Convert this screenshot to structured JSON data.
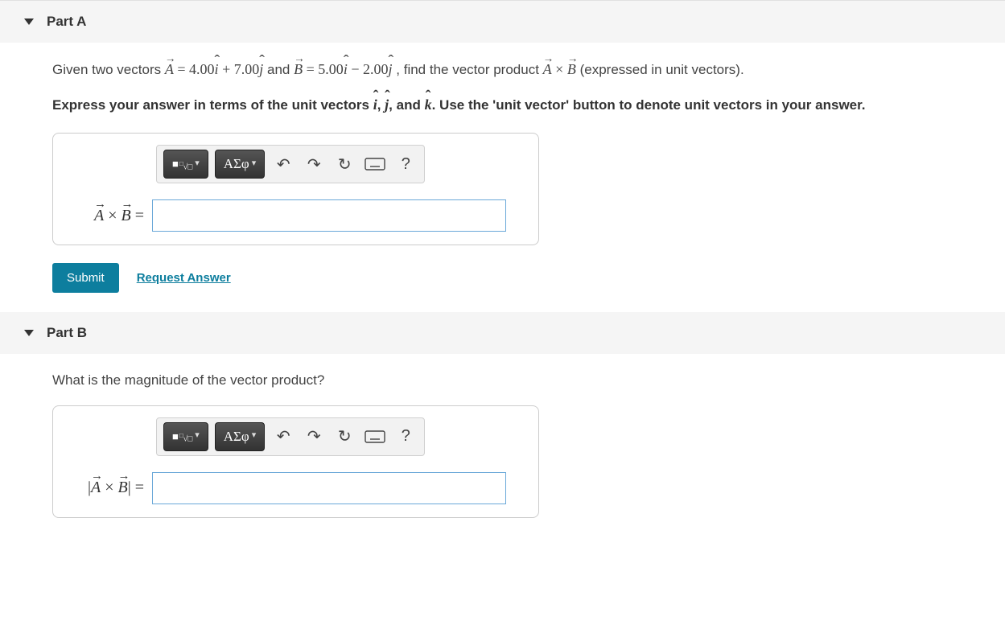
{
  "partA": {
    "title": "Part A",
    "question_prefix": "Given two vectors ",
    "A_expr_lhs": "A",
    "eq1": " = 4.00",
    "i1": "i",
    "plus": " + 7.00",
    "j1": "j",
    "and": " and ",
    "B_expr_lhs": "B",
    "eq2": " = 5.00",
    "i2": "i",
    "minus": " − 2.00",
    "j2": "j",
    "tail": " , find the vector product ",
    "Aagain": "A",
    "times": " × ",
    "Bagain": "B",
    "tail2": " (expressed in unit vectors).",
    "instruction_a": "Express your answer in terms of the unit vectors ",
    "ihat": "i",
    "comma1": ", ",
    "jhat": "j",
    "comma2": ", and ",
    "khat": "k",
    "instruction_b": ". Use the 'unit vector' button to denote unit vectors in your answer.",
    "eq_label_A": "A",
    "eq_label_times": " × ",
    "eq_label_B": "B",
    "eq_label_eq": " ="
  },
  "partB": {
    "title": "Part B",
    "question": "What is the magnitude of the vector product?",
    "eq_label_open": "|",
    "eq_label_A": "A",
    "eq_label_times": " × ",
    "eq_label_B": "B",
    "eq_label_close": "|",
    "eq_label_eq": " ="
  },
  "toolbar": {
    "templates": "■",
    "root": "√□",
    "root_prefix": "□",
    "greek": "ΑΣφ",
    "undo": "↶",
    "redo": "↷",
    "reset": "↻",
    "help": "?"
  },
  "actions": {
    "submit": "Submit",
    "request": "Request Answer"
  }
}
